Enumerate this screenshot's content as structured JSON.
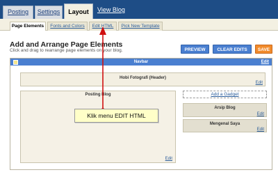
{
  "tabs": {
    "posting": "Posting",
    "settings": "Settings",
    "layout": "Layout",
    "view_blog": "View Blog"
  },
  "subtabs": {
    "page_elements": "Page Elements",
    "fonts_colors": "Fonts and Colors",
    "edit_html": "Edit HTML",
    "pick_template": "Pick New Template"
  },
  "heading": {
    "title": "Add and Arrange Page Elements",
    "subtitle": "Click and drag to rearrange page elements on your blog."
  },
  "buttons": {
    "preview": "PREVIEW",
    "clear_edits": "CLEAR EDITS",
    "save": "SAVE"
  },
  "editor": {
    "navbar_title": "Navbar",
    "header_title": "Hobi Fotografi (Header)",
    "posts_title": "Posting Blog",
    "add_gadget": "Add a Gadget",
    "arsip_title": "Arsip Blog",
    "mengenal_title": "Mengenal Saya",
    "edit_label": "Edit"
  },
  "annotation": {
    "text": "Klik menu EDIT HTML"
  },
  "colors": {
    "top_bar": "#1e4d86",
    "accent_blue": "#4a7fd0",
    "save_orange": "#f18b2c",
    "arrow_red": "#d01010"
  }
}
